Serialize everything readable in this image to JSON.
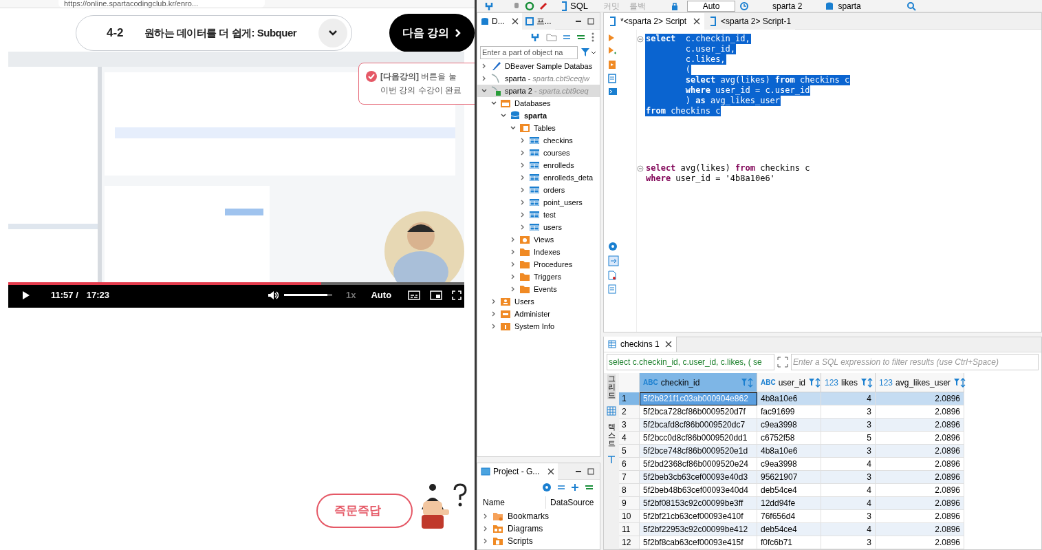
{
  "browser": {
    "url": "https://online.spartacodingclub.kr/enro..."
  },
  "lecture": {
    "number": "4-2",
    "title": "원하는 데이터를 더 쉽게: Subquer",
    "next_button": "다음 강의"
  },
  "toast": {
    "lines": [
      "**[다음강의]** 버튼을 눌",
      "이번 강의 수강이 완료"
    ]
  },
  "video": {
    "kind": "picture",
    "progress": {
      "level": 0.687
    },
    "current_time": "11:57 /",
    "duration": "17:23",
    "volume": {
      "level": 0.9
    },
    "speed": "1x",
    "quality": "Auto"
  },
  "qa_button": {
    "label": "즉문즉답"
  },
  "dbeaver": {
    "toolbar": {
      "sql": "SQL",
      "commit": "커밋",
      "rollback": "롤백",
      "mode": "Auto",
      "connection": "sparta 2",
      "schema": "sparta"
    },
    "navigator": {
      "tabs": [
        {
          "label": "D...",
          "selected": true
        },
        {
          "label": "프...",
          "selected": false
        }
      ],
      "filter_placeholder": "Enter a part of object na",
      "tree": [
        {
          "label": "DBeaver Sample Databas",
          "kind": "sample",
          "expanded": false,
          "selected": false
        },
        {
          "label": "sparta",
          "detail": "- sparta.cbt9ceqjw",
          "kind": "connection",
          "expanded": false,
          "selected": false
        },
        {
          "label": "sparta 2",
          "detail": "- sparta.cbt9ceq",
          "kind": "connection-ok",
          "expanded": true,
          "selected": true,
          "children": [
            {
              "label": "Databases",
              "kind": "databases",
              "expanded": true,
              "selected": false,
              "children": [
                {
                  "label": "sparta",
                  "kind": "schema",
                  "bold": true,
                  "expanded": true,
                  "selected": false,
                  "children": [
                    {
                      "label": "Tables",
                      "kind": "tables",
                      "expanded": true,
                      "selected": false,
                      "children": [
                        {
                          "label": "checkins",
                          "kind": "table",
                          "expanded": false,
                          "selected": false
                        },
                        {
                          "label": "courses",
                          "kind": "table",
                          "expanded": false,
                          "selected": false
                        },
                        {
                          "label": "enrolleds",
                          "kind": "table",
                          "expanded": false,
                          "selected": false
                        },
                        {
                          "label": "enrolleds_deta",
                          "kind": "table",
                          "expanded": false,
                          "selected": false
                        },
                        {
                          "label": "orders",
                          "kind": "table",
                          "expanded": false,
                          "selected": false
                        },
                        {
                          "label": "point_users",
                          "kind": "table",
                          "expanded": false,
                          "selected": false
                        },
                        {
                          "label": "test",
                          "kind": "table",
                          "expanded": false,
                          "selected": false
                        },
                        {
                          "label": "users",
                          "kind": "table",
                          "expanded": false,
                          "selected": false
                        }
                      ]
                    },
                    {
                      "label": "Views",
                      "kind": "views",
                      "expanded": false,
                      "selected": false
                    },
                    {
                      "label": "Indexes",
                      "kind": "folder",
                      "expanded": false,
                      "selected": false
                    },
                    {
                      "label": "Procedures",
                      "kind": "folder",
                      "expanded": false,
                      "selected": false
                    },
                    {
                      "label": "Triggers",
                      "kind": "folder",
                      "expanded": false,
                      "selected": false
                    },
                    {
                      "label": "Events",
                      "kind": "folder",
                      "expanded": false,
                      "selected": false
                    }
                  ]
                }
              ]
            },
            {
              "label": "Users",
              "kind": "users",
              "expanded": false,
              "selected": false
            },
            {
              "label": "Administer",
              "kind": "admin",
              "expanded": false,
              "selected": false
            },
            {
              "label": "System Info",
              "kind": "info",
              "expanded": false,
              "selected": false
            }
          ]
        }
      ]
    },
    "project": {
      "title": "Project - G...",
      "columns": [
        "Name",
        "DataSource"
      ],
      "items": [
        {
          "label": "Bookmarks",
          "kind": "bookmarks"
        },
        {
          "label": "Diagrams",
          "kind": "diagrams"
        },
        {
          "label": "Scripts",
          "kind": "scripts"
        }
      ]
    },
    "editor": {
      "tabs": [
        {
          "label": "*<sparta 2> Script",
          "selected": true
        },
        {
          "label": "<sparta 2> Script-1",
          "selected": false
        }
      ],
      "blocks": [
        {
          "selected": true,
          "lines": [
            "**select**  c.checkin_id,",
            "        c.user_id,",
            "        c.likes,",
            "        (",
            "        **select** avg(likes) **from** checkins c",
            "        **where** user_id = c.user_id",
            "        ) **as** avg_likes_user",
            "**from** checkins c"
          ]
        },
        {
          "selected": false,
          "lines": [
            "**select** avg(likes) **from** checkins c",
            "**where** user_id = '4b8a10e6'"
          ]
        }
      ]
    },
    "results": {
      "tab": "checkins 1",
      "query": "select c.checkin_id, c.user_id, c.likes, ( se",
      "filter_placeholder": "Enter a SQL expression to filter results (use Ctrl+Space)",
      "side_tabs": [
        {
          "label": "그리드",
          "selected": true
        },
        {
          "label": "텍스트",
          "selected": false
        }
      ],
      "columns": [
        {
          "label": "checkin_id",
          "type": "ABC",
          "numeric": false,
          "selected": true
        },
        {
          "label": "user_id",
          "type": "ABC",
          "numeric": false,
          "selected": false
        },
        {
          "label": "likes",
          "type": "123",
          "numeric": true,
          "selected": false
        },
        {
          "label": "avg_likes_user",
          "type": "123",
          "numeric": true,
          "selected": false
        }
      ],
      "rows": [
        {
          "number": "1",
          "cells": [
            "5f2b821f1c03ab000904e862",
            "4b8a10e6",
            "4",
            "2.0896"
          ],
          "selected": true
        },
        {
          "number": "2",
          "cells": [
            "5f2bca728cf86b0009520d7f",
            "fac91699",
            "3",
            "2.0896"
          ],
          "selected": false
        },
        {
          "number": "3",
          "cells": [
            "5f2bcafd8cf86b0009520dc7",
            "c9ea3998",
            "3",
            "2.0896"
          ],
          "selected": false
        },
        {
          "number": "4",
          "cells": [
            "5f2bcc0d8cf86b0009520dd1",
            "c6752f58",
            "5",
            "2.0896"
          ],
          "selected": false
        },
        {
          "number": "5",
          "cells": [
            "5f2bce748cf86b0009520e1d",
            "4b8a10e6",
            "3",
            "2.0896"
          ],
          "selected": false
        },
        {
          "number": "6",
          "cells": [
            "5f2bd2368cf86b0009520e24",
            "c9ea3998",
            "4",
            "2.0896"
          ],
          "selected": false
        },
        {
          "number": "7",
          "cells": [
            "5f2beb3cb63cef00093e40d3",
            "95621907",
            "3",
            "2.0896"
          ],
          "selected": false
        },
        {
          "number": "8",
          "cells": [
            "5f2beb48b63cef00093e40d4",
            "deb54ce4",
            "4",
            "2.0896"
          ],
          "selected": false
        },
        {
          "number": "9",
          "cells": [
            "5f2bf08153c92c00099be3ff",
            "12dd94fe",
            "4",
            "2.0896"
          ],
          "selected": false
        },
        {
          "number": "10",
          "cells": [
            "5f2bf21cb63cef00093e410f",
            "76f656d4",
            "3",
            "2.0896"
          ],
          "selected": false
        },
        {
          "number": "11",
          "cells": [
            "5f2bf22953c92c00099be412",
            "deb54ce4",
            "4",
            "2.0896"
          ],
          "selected": false
        },
        {
          "number": "12",
          "cells": [
            "5f2bf8cab63cef00093e415f",
            "f0fc6b71",
            "3",
            "2.0896"
          ],
          "selected": false
        }
      ]
    }
  }
}
